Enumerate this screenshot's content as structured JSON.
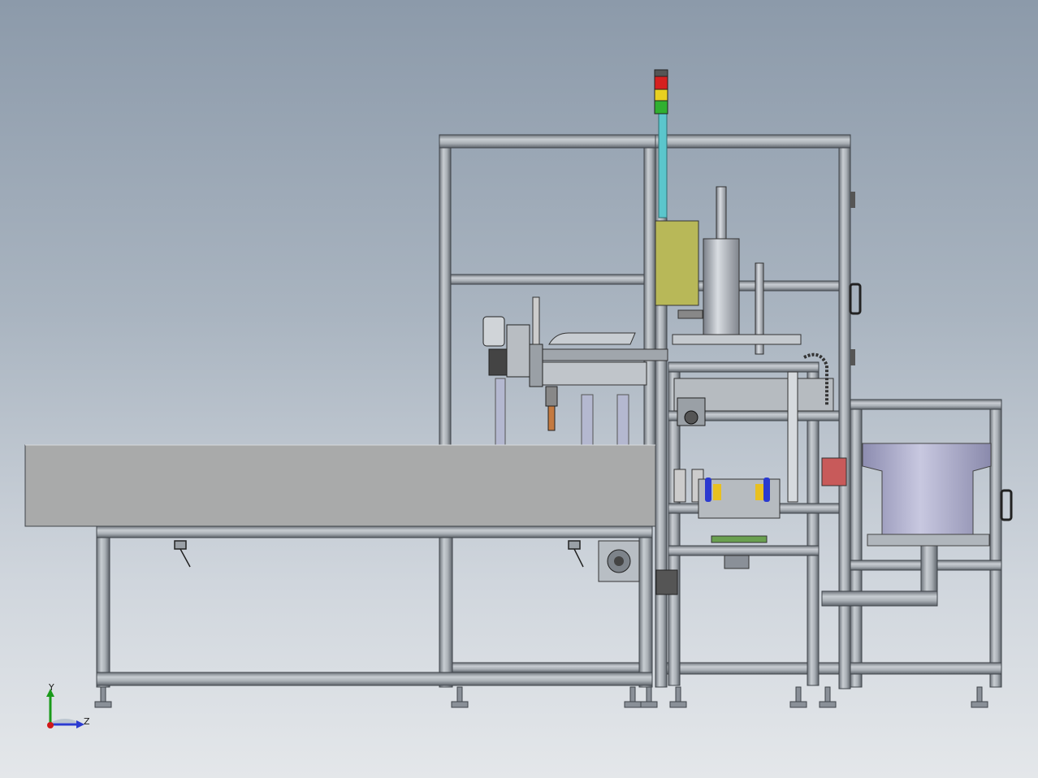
{
  "view": {
    "background_top": "#8c9aaa",
    "background_bottom": "#e4e7ea"
  },
  "triad": {
    "y_label": "Y",
    "z_label": "Z",
    "y_color": "#1a9a1a",
    "z_color": "#2a3ad0",
    "x_color": "#d01818"
  },
  "colors": {
    "frame": "#9aa0a6",
    "frame_dark": "#5a5f66",
    "conveyor": "#a9aaaa",
    "control_box": "#b8b858",
    "tower_red": "#d62020",
    "tower_yellow": "#e8d020",
    "tower_green": "#30b030",
    "tower_pole": "#5bc6cc",
    "feeder_bowl": "#a8a8c8",
    "pink_part": "#c85a5a",
    "green_plate": "#6aa050"
  }
}
